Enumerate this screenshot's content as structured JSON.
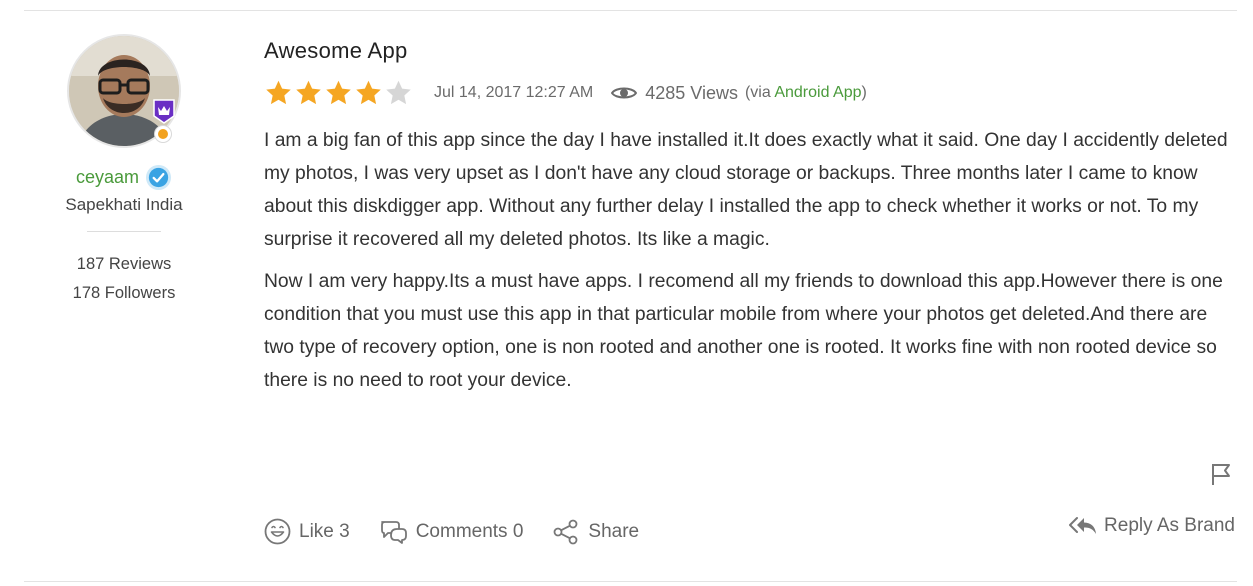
{
  "user": {
    "username": "ceyaam",
    "location": "Sapekhati India",
    "reviews_count": "187 Reviews",
    "followers_count": "178 Followers",
    "verified": true
  },
  "review": {
    "title": "Awesome App",
    "rating": 4,
    "rating_max": 5,
    "date": "Jul 14, 2017 12:27 AM",
    "views": "4285 Views",
    "via_prefix": "(via ",
    "via_source": "Android App",
    "via_suffix": ")",
    "paragraphs": [
      "I am a big fan of this app since the day I have installed it.It does exactly what it said. One day I accidently deleted my photos, I was very upset as I don't have any cloud storage or backups. Three months later I came to know about this diskdigger app. Without any further delay I installed the app to check whether it works or not. To my surprise it recovered all my deleted photos. Its like a magic.",
      "Now I am very happy.Its a must have apps. I recomend all my friends to download this app.However there is one condition that you must use this app in that particular mobile from where your photos get deleted.And there are two type of recovery option, one is non rooted and another one is rooted. It works fine with non rooted device so there is no need to root your device."
    ]
  },
  "actions": {
    "like_label": "Like 3",
    "comments_label": "Comments 0",
    "share_label": "Share",
    "reply_label": "Reply As Brand"
  },
  "icons": {
    "star_filled": "star-icon",
    "star_empty": "star-icon",
    "views": "eye-icon",
    "like": "smiley-icon",
    "comments": "speech-bubbles-icon",
    "share": "share-icon",
    "report": "flag-icon",
    "reply": "reply-all-icon",
    "verified": "verified-check-icon",
    "level": "crown-badge-icon"
  },
  "colors": {
    "accent_green": "#4a9a3b",
    "star_filled": "#f5a623",
    "star_empty": "#d6d6d6",
    "verified_blue": "#3aa3e3",
    "level_purple": "#6a2fc4",
    "level_orange": "#f2a21f"
  }
}
